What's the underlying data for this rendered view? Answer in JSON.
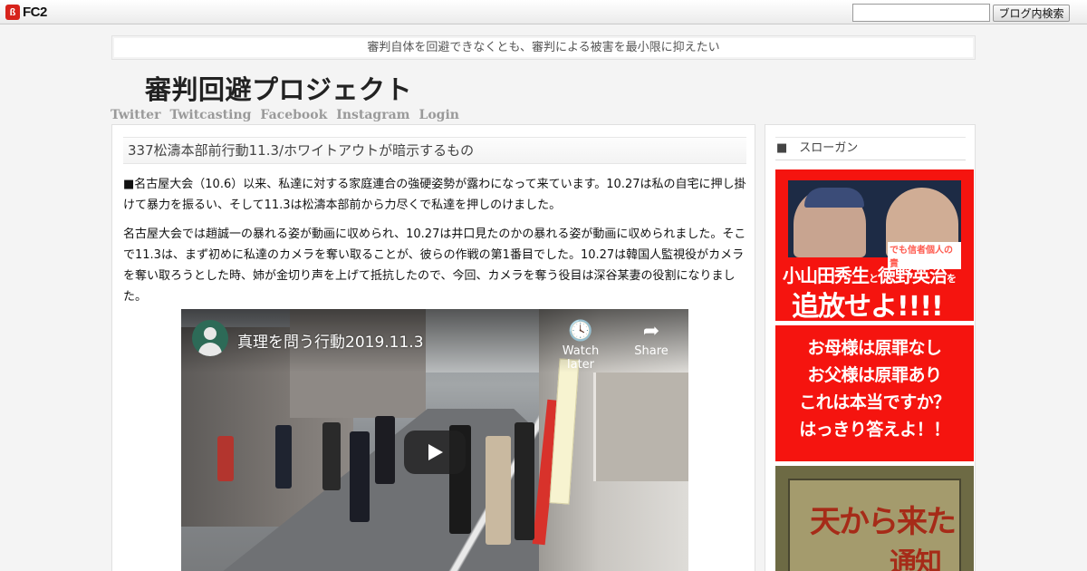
{
  "fc2": {
    "logo_text": "FC2",
    "logo_mark": "ß",
    "search_placeholder": "",
    "search_button": "ブログ内検索"
  },
  "blog": {
    "tagline": "審判自体を回避できなくとも、審判による被害を最小限に抑えたい",
    "title": "審判回避プロジェクト",
    "nav": [
      "Twitter",
      "Twitcasting",
      "Facebook",
      "Instagram",
      "Login"
    ]
  },
  "post": {
    "title": "337松濤本部前行動11.3/ホワイトアウトが暗示するもの",
    "paragraphs": [
      "■名古屋大会（10.6）以来、私達に対する家庭連合の強硬姿勢が露わになって来ています。10.27は私の自宅に押し掛けて暴力を振るい、そして11.3は松濤本部前から力尽くで私達を押しのけました。",
      "名古屋大会では趙誠一の暴れる姿が動画に収められ、10.27は井口見たのかの暴れる姿が動画に収められました。そこで11.3は、まず初めに私達のカメラを奪い取ることが、彼らの作戦の第1番目でした。10.27は韓国人監視役がカメラを奪い取ろうとした時、姉が金切り声を上げて抵抗したので、今回、カメラを奪う役目は深谷某妻の役割になりました。"
    ],
    "video": {
      "title": "真理を問う行動2019.11.3",
      "watch_later": "Watch later",
      "share": "Share"
    }
  },
  "sidebar": {
    "heading": "■　スローガン",
    "banner1": {
      "mini_caption": "でも信者個人の責",
      "name1": "小山田秀生",
      "connector": "と",
      "name2": "徳野英治",
      "particle": "を",
      "command": "追放せよ!!!!"
    },
    "banner2": [
      "お母様は原罪なし",
      "お父様は原罪あり",
      "これは本当ですか？",
      "はっきり答えよ！！"
    ],
    "banner3": {
      "line1": "天から来た",
      "line2": "通知"
    }
  }
}
